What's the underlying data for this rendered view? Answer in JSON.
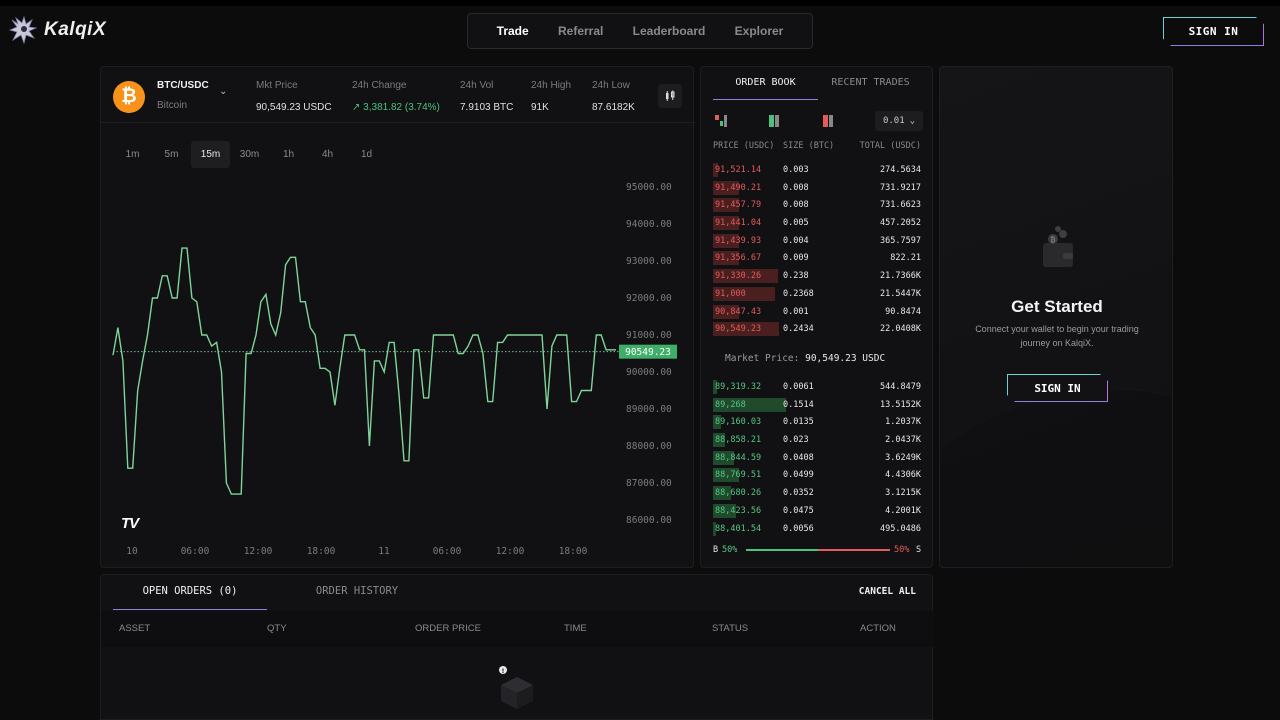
{
  "app": {
    "brand": "KalqiX"
  },
  "nav": {
    "items": [
      "Trade",
      "Referral",
      "Leaderboard",
      "Explorer"
    ],
    "active": "Trade"
  },
  "header": {
    "signin_label": "SIGN IN"
  },
  "ticker": {
    "pair": "BTC/USDC",
    "name": "Bitcoin",
    "coin_symbol": "₿",
    "stats": [
      {
        "label": "Mkt Price",
        "value": "90,549.23 USDC"
      },
      {
        "label": "24h Change",
        "value": "3,381.82 (3.74%)"
      },
      {
        "label": "24h Vol",
        "value": "7.9103 BTC"
      },
      {
        "label": "24h High",
        "value": "91K"
      },
      {
        "label": "24h Low",
        "value": "87.6182K"
      }
    ]
  },
  "timeframes": {
    "items": [
      "1m",
      "5m",
      "15m",
      "30m",
      "1h",
      "4h",
      "1d"
    ],
    "active": "15m"
  },
  "chart_data": {
    "type": "line",
    "y_ticks": [
      "95000.00",
      "94000.00",
      "93000.00",
      "92000.00",
      "91000.00",
      "90000.00",
      "89000.00",
      "88000.00",
      "87000.00",
      "86000.00"
    ],
    "x_ticks": [
      "10",
      "06:00",
      "12:00",
      "18:00",
      "11",
      "06:00",
      "12:00",
      "18:00"
    ],
    "ylim": [
      86000,
      95000
    ],
    "current_price_label": "90549.23",
    "current_price": 90549.23,
    "line_color": "#7fd49a",
    "values": [
      90450,
      91200,
      90300,
      87400,
      87400,
      89500,
      90300,
      91000,
      92000,
      92000,
      92600,
      92600,
      92000,
      92000,
      93350,
      93350,
      92000,
      91900,
      91000,
      91000,
      90700,
      90800,
      90000,
      87000,
      86700,
      86700,
      86700,
      90500,
      90500,
      91000,
      91900,
      92100,
      91300,
      91000,
      91600,
      92900,
      93100,
      93100,
      91900,
      91900,
      91200,
      91000,
      90100,
      90100,
      90000,
      89100,
      90100,
      91000,
      91000,
      91000,
      90600,
      90600,
      88000,
      90300,
      90300,
      90000,
      90800,
      90800,
      89400,
      87600,
      87600,
      90600,
      90600,
      89300,
      89300,
      91000,
      91000,
      91000,
      91000,
      91000,
      90500,
      90500,
      90700,
      91000,
      91000,
      90500,
      89200,
      89200,
      90800,
      90800,
      91000,
      91000,
      91000,
      91000,
      91000,
      91000,
      91000,
      91000,
      89000,
      90700,
      91000,
      91000,
      91000,
      89200,
      89200,
      89500,
      89500,
      89500,
      91000,
      91000,
      90600,
      90600,
      90600
    ]
  },
  "orderbook": {
    "tabs": [
      "ORDER BOOK",
      "RECENT TRADES"
    ],
    "active_tab": "ORDER BOOK",
    "precision": "0.01",
    "headers": {
      "price": "PRICE (USDC)",
      "size": "SIZE (BTC)",
      "total": "TOTAL (USDC)"
    },
    "asks": [
      {
        "price": "91,521.14",
        "size": "0.003",
        "total": "274.5634",
        "depth": 0.04
      },
      {
        "price": "91,490.21",
        "size": "0.008",
        "total": "731.9217",
        "depth": 0.2
      },
      {
        "price": "91,457.79",
        "size": "0.008",
        "total": "731.6623",
        "depth": 0.2
      },
      {
        "price": "91,441.04",
        "size": "0.005",
        "total": "457.2052",
        "depth": 0.2
      },
      {
        "price": "91,439.93",
        "size": "0.004",
        "total": "365.7597",
        "depth": 0.2
      },
      {
        "price": "91,356.67",
        "size": "0.009",
        "total": "822.21",
        "depth": 0.2
      },
      {
        "price": "91,330.26",
        "size": "0.238",
        "total": "21.7366K",
        "depth": 0.5
      },
      {
        "price": "91,000",
        "size": "0.2368",
        "total": "21.5447K",
        "depth": 0.48
      },
      {
        "price": "90,847.43",
        "size": "0.001",
        "total": "90.8474",
        "depth": 0.2
      },
      {
        "price": "90,549.23",
        "size": "0.2434",
        "total": "22.0408K",
        "depth": 0.51
      }
    ],
    "market_price_label": "Market Price:",
    "market_price_value": "90,549.23 USDC",
    "bids": [
      {
        "price": "89,319.32",
        "size": "0.0061",
        "total": "544.8479",
        "depth": 0.03
      },
      {
        "price": "89,268",
        "size": "0.1514",
        "total": "13.5152K",
        "depth": 0.56
      },
      {
        "price": "89,160.03",
        "size": "0.0135",
        "total": "1.2037K",
        "depth": 0.06
      },
      {
        "price": "88,858.21",
        "size": "0.023",
        "total": "2.0437K",
        "depth": 0.09
      },
      {
        "price": "88,844.59",
        "size": "0.0408",
        "total": "3.6249K",
        "depth": 0.16
      },
      {
        "price": "88,769.51",
        "size": "0.0499",
        "total": "4.4306K",
        "depth": 0.2
      },
      {
        "price": "88,680.26",
        "size": "0.0352",
        "total": "3.1215K",
        "depth": 0.14
      },
      {
        "price": "88,423.56",
        "size": "0.0475",
        "total": "4.2001K",
        "depth": 0.18
      },
      {
        "price": "88,401.54",
        "size": "0.0056",
        "total": "495.0486",
        "depth": 0.02
      }
    ],
    "buy_label": "B",
    "buy_pct": "50%",
    "sell_pct": "50%",
    "sell_label": "S"
  },
  "get_started": {
    "title": "Get Started",
    "description": "Connect your wallet to begin your trading journey on KalqiX.",
    "button": "SIGN IN"
  },
  "orders": {
    "tabs": [
      "OPEN ORDERS (0)",
      "ORDER HISTORY"
    ],
    "active_tab": "OPEN ORDERS (0)",
    "cancel_all": "CANCEL ALL",
    "columns": [
      "ASSET",
      "QTY",
      "ORDER PRICE",
      "TIME",
      "STATUS",
      "ACTION"
    ]
  },
  "colors": {
    "accent_green": "#4cc17e",
    "accent_red": "#e35b5b",
    "coin": "#f7931a",
    "gradient_cyan": "#6fd0d6",
    "gradient_purple": "#b070e0"
  },
  "icons": {
    "logo": "dragon-logo-icon",
    "candles": "candlestick-icon",
    "wallet": "wallet-icon",
    "empty": "empty-box-icon",
    "tradingview": "tradingview-logo-icon"
  }
}
